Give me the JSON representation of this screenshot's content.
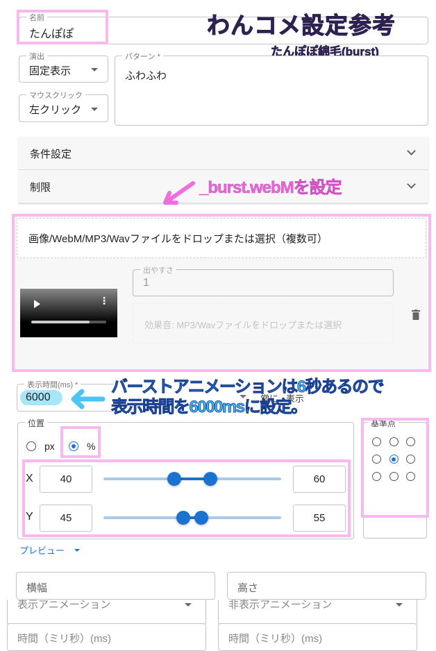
{
  "overlay": {
    "title": "わんコメ設定参考",
    "subtitle": "たんぽぽ綿毛(burst)",
    "note_webm": "_burst.webMを設定",
    "note_time_line1": "バーストアニメーションは6秒あるので",
    "note_time_line2": "表示時間を6000msに設定。"
  },
  "name": {
    "label": "名前",
    "value": "たんぽぽ"
  },
  "effect": {
    "label": "演出",
    "value": "固定表示"
  },
  "mouse": {
    "label": "マウスクリック",
    "value": "左クリック"
  },
  "pattern": {
    "label": "パターン *",
    "value": "ふわふわ"
  },
  "accordions": [
    {
      "label": "条件設定"
    },
    {
      "label": "制限"
    }
  ],
  "dropzone": {
    "text": "画像/WebM/MP3/Wavファイルをドロップまたは選択（複数可）"
  },
  "media": {
    "likelihood_label": "出やすさ",
    "likelihood_value": "1",
    "sound_placeholder": "効果音: MP3/Wavファイルをドロップまたは選択",
    "progress": 0.78
  },
  "duration": {
    "label": "表示時間(ms) *",
    "value": "6000",
    "always_label": "常に...表示"
  },
  "position": {
    "label": "位置",
    "unit_px": "px",
    "unit_pct": "%",
    "selected_unit": "%",
    "x": {
      "label": "X",
      "min": "40",
      "max": "60",
      "range": [
        40,
        60
      ]
    },
    "y": {
      "label": "Y",
      "min": "45",
      "max": "55",
      "range": [
        45,
        55
      ]
    }
  },
  "anchor": {
    "label": "基準点",
    "selected": 4
  },
  "preview": {
    "label": "プレビュー"
  },
  "size": {
    "width_placeholder": "横幅",
    "height_placeholder": "高さ"
  },
  "animation": {
    "show_label": "表示アニメーション",
    "hide_label": "非表示アニメーション",
    "show_time": "時間（ミリ秒）(ms)",
    "hide_time": "時間（ミリ秒）(ms)"
  },
  "colors": {
    "accent": "#1a73d1",
    "highlight_pink": "#f9b8ee",
    "title": "#2d2250"
  }
}
